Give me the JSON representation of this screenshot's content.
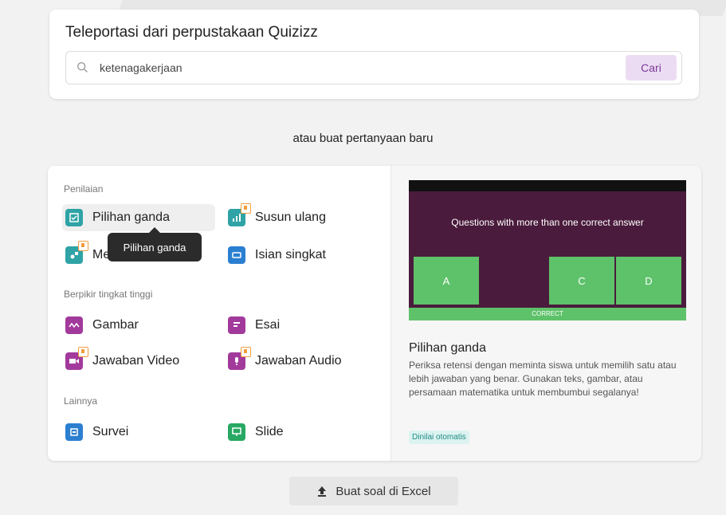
{
  "library": {
    "title": "Teleportasi dari perpustakaan Quizizz",
    "search_value": "ketenagakerjaan",
    "search_button": "Cari"
  },
  "or_text": "atau buat pertanyaan baru",
  "sections": {
    "assessment": "Penilaian",
    "higher_order": "Berpikir tingkat tinggi",
    "others": "Lainnya"
  },
  "question_types": {
    "multiple_choice": "Pilihan ganda",
    "reorder": "Susun ulang",
    "match": "Mencocokkan",
    "short_answer": "Isian singkat",
    "draw": "Gambar",
    "essay": "Esai",
    "video_response": "Jawaban Video",
    "audio_response": "Jawaban Audio",
    "poll": "Survei",
    "slide": "Slide"
  },
  "tooltip": "Pilihan ganda",
  "preview": {
    "question": "Questions with more than one correct answer",
    "answers": [
      "A",
      "C",
      "D"
    ],
    "correct_label": "CORRECT",
    "title": "Pilihan ganda",
    "description": "Periksa retensi dengan meminta siswa untuk memilih satu atau lebih jawaban yang benar. Gunakan teks, gambar, atau persamaan matematika untuk membumbui segalanya!",
    "tag": "Dinilai otomatis"
  },
  "excel_button": "Buat soal di Excel",
  "colors": {
    "teal": "#2fa3a6",
    "blue": "#2b7fd1",
    "purple": "#a23a9c",
    "green": "#27a863",
    "accent": "#7b3a96"
  }
}
